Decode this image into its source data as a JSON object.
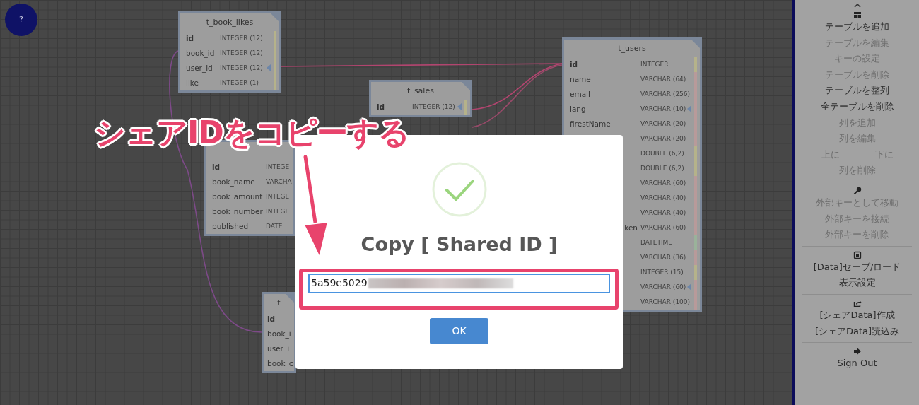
{
  "help_button": {
    "label": "?"
  },
  "tables": [
    {
      "title": "t_book_likes",
      "rows": [
        {
          "name": "id",
          "type": "INTEGER (12)",
          "primary": true,
          "linked": false,
          "color": "#b5b28a"
        },
        {
          "name": "book_id",
          "type": "INTEGER (12)",
          "primary": false,
          "linked": false,
          "color": "#b5b28a"
        },
        {
          "name": "user_id",
          "type": "INTEGER (12)",
          "primary": false,
          "linked": true,
          "color": "#b5b28a"
        },
        {
          "name": "like",
          "type": "INTEGER (1)",
          "primary": false,
          "linked": false,
          "color": "#b5b28a"
        }
      ]
    },
    {
      "title": "t_sales",
      "rows": [
        {
          "name": "id",
          "type": "INTEGER (12)",
          "primary": true,
          "linked": true,
          "color": "#b5b28a"
        }
      ]
    },
    {
      "rows": [
        {
          "name": "id",
          "type": "INTEGE",
          "primary": true,
          "linked": false
        },
        {
          "name": "book_name",
          "type": "VARCHA",
          "primary": false,
          "linked": false
        },
        {
          "name": "book_amount",
          "type": "INTEGE",
          "primary": false,
          "linked": false
        },
        {
          "name": "book_number",
          "type": "INTEGE",
          "primary": false,
          "linked": false
        },
        {
          "name": "published",
          "type": "DATE",
          "primary": false,
          "linked": false
        }
      ]
    },
    {
      "title": "t",
      "rows": [
        {
          "name": "id",
          "primary": true,
          "linked": false
        },
        {
          "name": "book_i",
          "primary": false,
          "linked": false
        },
        {
          "name": "user_i",
          "primary": false,
          "linked": false
        },
        {
          "name": "book_c",
          "primary": false,
          "linked": false
        }
      ]
    },
    {
      "title": "t_users",
      "rows": [
        {
          "name": "id",
          "type": "INTEGER",
          "primary": true,
          "linked": false,
          "color": "#b5b28a"
        },
        {
          "name": "name",
          "type": "VARCHAR (64)",
          "primary": false,
          "linked": false,
          "color": "#b89a9a"
        },
        {
          "name": "email",
          "type": "VARCHAR (256)",
          "primary": false,
          "linked": false,
          "color": "#b89a9a"
        },
        {
          "name": "lang",
          "type": "VARCHAR (10)",
          "primary": false,
          "linked": true,
          "color": "#b89a9a"
        },
        {
          "name": "firestName",
          "type": "VARCHAR (20)",
          "primary": false,
          "linked": false,
          "color": "#b89a9a"
        },
        {
          "type": "VARCHAR (20)",
          "primary": false,
          "linked": false,
          "color": "#b89a9a"
        },
        {
          "type": "DOUBLE (6,2)",
          "primary": false,
          "linked": false,
          "color": "#b5b28a"
        },
        {
          "type": "DOUBLE (6,2)",
          "primary": false,
          "linked": false,
          "color": "#b5b28a"
        },
        {
          "type": "VARCHAR (60)",
          "primary": false,
          "linked": false,
          "color": "#b89a9a"
        },
        {
          "type": "VARCHAR (40)",
          "primary": false,
          "linked": false,
          "color": "#b89a9a"
        },
        {
          "type": "VARCHAR (40)",
          "primary": false,
          "linked": false,
          "color": "#b89a9a"
        },
        {
          "name": "ken",
          "type": "VARCHAR (60)",
          "primary": false,
          "linked": false,
          "clipped_left": true,
          "color": "#b89a9a"
        },
        {
          "type": "DATETIME",
          "primary": false,
          "linked": false,
          "color": "#9ab29a"
        },
        {
          "type": "VARCHAR (36)",
          "primary": false,
          "linked": false,
          "color": "#b89a9a"
        },
        {
          "type": "INTEGER (15)",
          "primary": false,
          "linked": false,
          "color": "#b5b28a"
        },
        {
          "type": "VARCHAR (60)",
          "primary": false,
          "linked": true,
          "color": "#b89a9a"
        },
        {
          "type": "VARCHAR (100)",
          "primary": false,
          "linked": false,
          "color": "#b89a9a"
        }
      ]
    }
  ],
  "dialog": {
    "title": "Copy [ Shared ID ]",
    "field_value": "5a59e5029",
    "button": "OK"
  },
  "annotation": {
    "text": "シェアIDをコピーする"
  },
  "sidebar": {
    "sections": [
      {
        "items": [
          {
            "kind": "single",
            "label": "テーブルを追加",
            "disabled": false
          },
          {
            "kind": "single",
            "label": "テーブルを編集",
            "disabled": true
          },
          {
            "kind": "single",
            "label": "キーの設定",
            "disabled": true
          },
          {
            "kind": "single",
            "label": "テーブルを削除",
            "disabled": true
          },
          {
            "kind": "single",
            "label": "テーブルを整列",
            "disabled": false
          },
          {
            "kind": "single",
            "label": "全テーブルを削除",
            "disabled": false
          },
          {
            "kind": "single",
            "label": "列を追加",
            "disabled": true
          },
          {
            "kind": "single",
            "label": "列を編集",
            "disabled": true
          },
          {
            "kind": "split",
            "labels": [
              "上に",
              "下に"
            ],
            "disabled": true
          },
          {
            "kind": "single",
            "label": "列を削除",
            "disabled": true
          }
        ]
      },
      {
        "items": [
          {
            "kind": "single",
            "label": "外部キーとして移動",
            "disabled": true
          },
          {
            "kind": "single",
            "label": "外部キーを接続",
            "disabled": true
          },
          {
            "kind": "single",
            "label": "外部キーを削除",
            "disabled": true
          }
        ]
      },
      {
        "items": [
          {
            "kind": "single",
            "label": "[Data]セーブ/ロード",
            "disabled": false
          },
          {
            "kind": "single",
            "label": "表示設定",
            "disabled": false
          }
        ]
      },
      {
        "items": [
          {
            "kind": "single",
            "label": "[シェアData]作成",
            "disabled": false
          },
          {
            "kind": "single",
            "label": "[シェアData]読込み",
            "disabled": false
          }
        ]
      },
      {
        "items": [
          {
            "kind": "single",
            "label": "Sign Out",
            "disabled": false
          }
        ]
      }
    ]
  }
}
